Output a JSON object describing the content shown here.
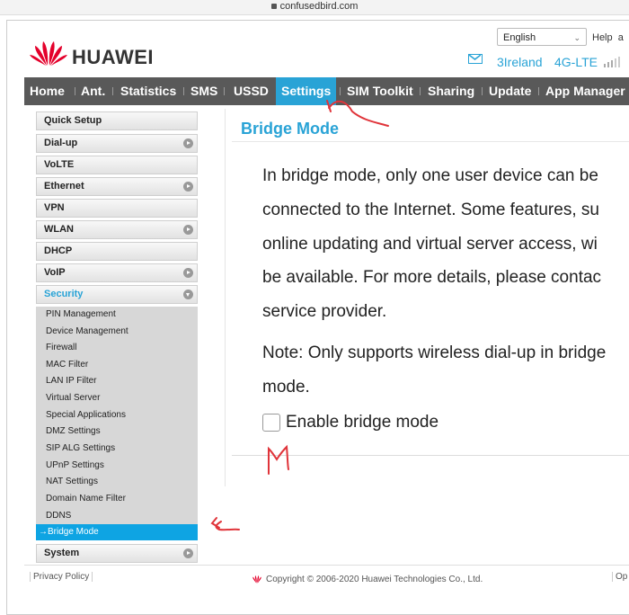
{
  "browser": {
    "url": "confusedbird.com"
  },
  "header": {
    "brand": "HUAWEI",
    "language": "English",
    "help": "Help",
    "help_overflow": "a",
    "operator": "3Ireland",
    "network": "4G-LTE",
    "brand_color": "#e4002b",
    "accent_color": "#29a3d6"
  },
  "nav": {
    "items": [
      "Home",
      "Ant.",
      "Statistics",
      "SMS",
      "USSD",
      "Settings",
      "SIM Toolkit",
      "Sharing",
      "Update",
      "App Manager"
    ],
    "active": "Settings"
  },
  "sidebar": {
    "items": [
      {
        "label": "Quick Setup",
        "expandable": false
      },
      {
        "label": "Dial-up",
        "expandable": true
      },
      {
        "label": "VoLTE",
        "expandable": false
      },
      {
        "label": "Ethernet",
        "expandable": true
      },
      {
        "label": "VPN",
        "expandable": false
      },
      {
        "label": "WLAN",
        "expandable": true
      },
      {
        "label": "DHCP",
        "expandable": false
      },
      {
        "label": "VoIP",
        "expandable": true
      },
      {
        "label": "Security",
        "expandable": true,
        "expanded": true
      },
      {
        "label": "System",
        "expandable": true
      }
    ],
    "security_submenu": [
      "PIN Management",
      "Device Management",
      "Firewall",
      "MAC Filter",
      "LAN IP Filter",
      "Virtual Server",
      "Special Applications",
      "DMZ Settings",
      "SIP ALG Settings",
      "UPnP Settings",
      "NAT Settings",
      "Domain Name Filter",
      "DDNS",
      "Bridge Mode"
    ],
    "active_submenu": "Bridge Mode",
    "active_arrow": "→"
  },
  "content": {
    "title": "Bridge Mode",
    "lines": [
      "In bridge mode, only one user device can be",
      "connected to the Internet. Some features, su",
      "online updating and virtual server access, wi",
      "be available. For more details, please contac",
      "service provider."
    ],
    "note_lines": [
      "Note: Only supports wireless dial-up in bridge",
      "mode."
    ],
    "checkbox_label": "Enable bridge mode",
    "checkbox_checked": false
  },
  "footer": {
    "privacy": "Privacy Policy",
    "copyright": "Copyright © 2006-2020 Huawei Technologies Co., Ltd.",
    "right_cut": "Op"
  }
}
